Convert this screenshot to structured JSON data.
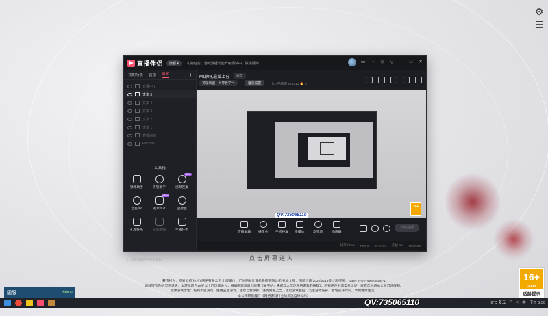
{
  "app": {
    "name": "直播伴侣",
    "version_badge": "旗舰 ▾",
    "notice": "礼物任务、游戏数据功能升级测试中，敬请期待",
    "tabs": [
      "我的场景",
      "直播",
      "画面"
    ],
    "active_tab_index": 2,
    "add_label": "+",
    "scenes": [
      "直播中 1",
      "文本 5",
      "文本 4",
      "文本 3",
      "文本 2",
      "文本 1",
      "直播画面",
      "Pencilla"
    ],
    "active_scene_index": 1,
    "tools_title": "工具箱",
    "tools": [
      {
        "label": "弹幕助手",
        "icon": "chat-icon",
        "badge": ""
      },
      {
        "label": "房管助手",
        "icon": "user-icon",
        "badge": ""
      },
      {
        "label": "视频连麦",
        "icon": "video-call-icon",
        "badge": "NEW"
      },
      {
        "label": "全民PK",
        "icon": "pk-icon",
        "badge": ""
      },
      {
        "label": "观众Buff",
        "icon": "buff-icon",
        "badge": "NEW"
      },
      {
        "label": "回放面",
        "icon": "replay-icon",
        "badge": ""
      },
      {
        "label": "礼物任务",
        "icon": "gift-icon",
        "badge": ""
      },
      {
        "label": "游戏数据",
        "icon": "data-icon",
        "badge": ""
      },
      {
        "label": "主播任务",
        "icon": "task-icon",
        "badge": ""
      }
    ],
    "left_bottom_text": "斗鱼直播伴侣更新帮助"
  },
  "stream": {
    "title": "M1狮吼最爱上分",
    "edit_label": "修改",
    "category": "英雄联盟 - 大神教学 ✎",
    "settings_label": "推流设置",
    "meta": "小九子画面  678312  🔥 4"
  },
  "preview": {
    "watermark": "QV:735065110",
    "age_small": "16+"
  },
  "toolbar": {
    "buttons": [
      {
        "label": "直播屏幕",
        "icon": "screen-icon"
      },
      {
        "label": "摄像头",
        "icon": "camera-icon"
      },
      {
        "label": "手机投屏",
        "icon": "phone-cast-icon"
      },
      {
        "label": "多媒体",
        "icon": "media-icon"
      },
      {
        "label": "麦克风",
        "icon": "mic-icon"
      },
      {
        "label": "扬声器",
        "icon": "speaker-icon"
      }
    ],
    "start_label": "开始直播"
  },
  "statusbar": [
    "码率 0kb/s",
    "FPS 0",
    "CPU 0%",
    "丢帧 0%",
    "00:00:00"
  ],
  "click_enter": "点击屏幕进入",
  "footer": [
    "著作权人：网易公司(杭州) 网络有限公司 出版单位：广州网易计算机系统有限公司 批准文号：国新出审[2020]2213号 出版物号：ISBN 978-7-498-08184-1",
    "适龄提示及防沉迷说明：本游戏适合16岁以上的玩家进入，根据国家新闻出版署《关于防止未成年人沉迷网络游戏的通知》，所有用户必须实名认证，未成年人将纳入防沉迷限制。",
    "健康游戏忠告：抵制不良游戏，拒绝盗版游戏，注意自我保护，谨防受骗上当，适度游戏益脑，沉迷游戏伤身，合理安排时间，享受健康生活。",
    "本公司积极履行《网络游戏行业防沉迷自律公约》"
  ],
  "age_rating": {
    "value": "16+",
    "sub": "CADPA",
    "label": "适龄提示"
  },
  "qv_big": "QV:735065110",
  "widget": {
    "label": "国服",
    "ping": "66ms"
  },
  "tray": {
    "weather": "6°C 多云",
    "ime": "中",
    "time": "下午 5:56"
  },
  "colors": {
    "accent": "#ff5a6e",
    "age": "#f2a900",
    "window": "#1c1d22"
  }
}
